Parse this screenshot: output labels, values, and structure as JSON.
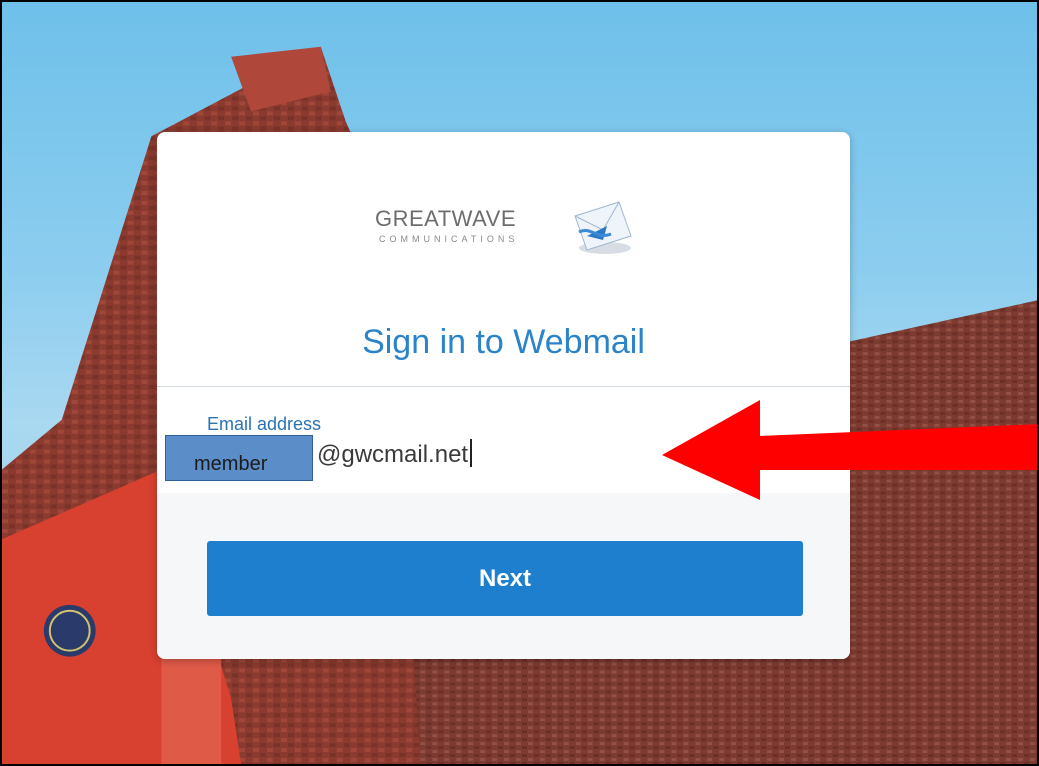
{
  "brand": {
    "name": "GREATWAVE",
    "tagline": "COMMUNICATIONS"
  },
  "login": {
    "title": "Sign in to Webmail",
    "email_label": "Email address",
    "email_username": "member",
    "email_domain": "@gwcmail.net",
    "next_label": "Next"
  },
  "colors": {
    "accent": "#2b84c9",
    "button": "#1d7fce",
    "annotation_arrow": "#ff0000"
  },
  "icons": {
    "logo_envelope": "envelope-icon",
    "annotation": "red-arrow-icon"
  }
}
